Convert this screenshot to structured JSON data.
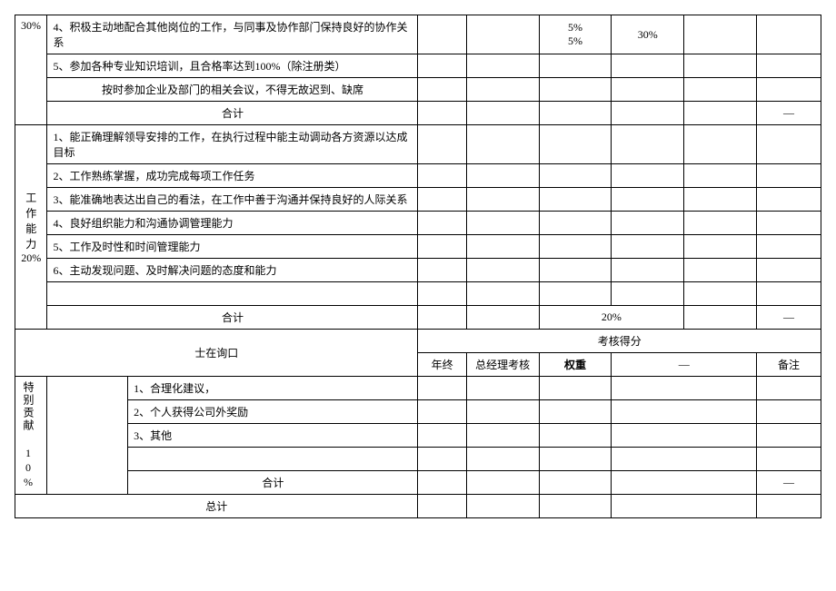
{
  "section1": {
    "label": "30%",
    "items": [
      "4、积极主动地配合其他岗位的工作，与同事及协作部门保持良好的协作关系",
      "5、参加各种专业知识培训，且合格率达到100%（除注册类）",
      "按时参加企业及部门的相关会议，不得无故迟到、缺席"
    ],
    "extraPercents": "5%\n5%",
    "extraPercent2": "30%",
    "subtotal": "合计",
    "subtotalDash": "—"
  },
  "section2": {
    "label": "工作能力20%",
    "items": [
      "1、能正确理解领导安排的工作，在执行过程中能主动调动各方资源以达成目标",
      "2、工作熟练掌握，成功完成每项工作任务",
      "3、能准确地表达出自己的看法，在工作中善于沟通并保持良好的人际关系",
      "4、良好组织能力和沟通协调管理能力",
      "5、工作及时性和时间管理能力",
      "6、主动发现问题、及时解决问题的态度和能力"
    ],
    "subtotal": "合计",
    "subtotalPercent": "20%",
    "subtotalDash": "—"
  },
  "header2": {
    "title": "士在询口",
    "score": "考核得分",
    "cols": [
      "年终",
      "总经理考核",
      "权重",
      "—",
      "备注"
    ]
  },
  "section3": {
    "label": "特别贡献 10%",
    "items": [
      "1、合理化建议，",
      "2、个人获得公司外奖励",
      "3、其他"
    ],
    "subtotal": "合计",
    "subtotalDash": "—"
  },
  "total": "总计"
}
